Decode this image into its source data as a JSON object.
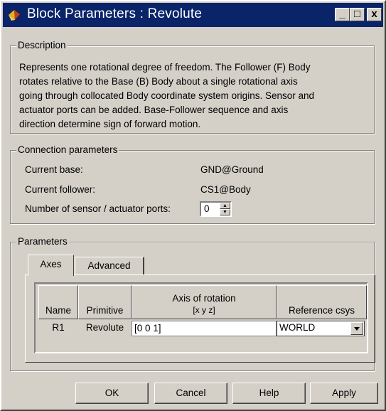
{
  "window": {
    "title": "Block Parameters : Revolute",
    "controls": {
      "minimize": "_",
      "maximize": "□",
      "close": "x"
    }
  },
  "description": {
    "legend": "Description",
    "lines": [
      "Represents one rotational degree of freedom. The Follower (F) Body",
      "rotates relative to the Base (B) Body about a single rotational axis",
      "going through collocated Body coordinate system origins. Sensor and",
      "actuator ports can be added. Base-Follower sequence and axis",
      "direction determine sign of forward motion."
    ]
  },
  "connection": {
    "legend": "Connection parameters",
    "current_base_label": "Current base:",
    "current_base_value": "GND@Ground",
    "current_follower_label": "Current follower:",
    "current_follower_value": "CS1@Body",
    "ports_label": "Number of sensor / actuator ports:",
    "ports_value": "0"
  },
  "parameters": {
    "legend": "Parameters",
    "tabs": [
      {
        "label": "Axes",
        "active": true
      },
      {
        "label": "Advanced",
        "active": false
      }
    ],
    "table": {
      "headers": {
        "name": "Name",
        "primitive": "Primitive",
        "axis_line1": "Axis of rotation",
        "axis_line2": "[x y z]",
        "ref": "Reference csys"
      },
      "rows": [
        {
          "name": "R1",
          "primitive": "Revolute",
          "axis": "[0 0 1]",
          "ref": "WORLD"
        }
      ]
    }
  },
  "buttons": {
    "ok": "OK",
    "cancel": "Cancel",
    "help": "Help",
    "apply": "Apply"
  },
  "colors": {
    "title_bar": "#0a246a",
    "dialog_face": "#d4d0c8"
  }
}
